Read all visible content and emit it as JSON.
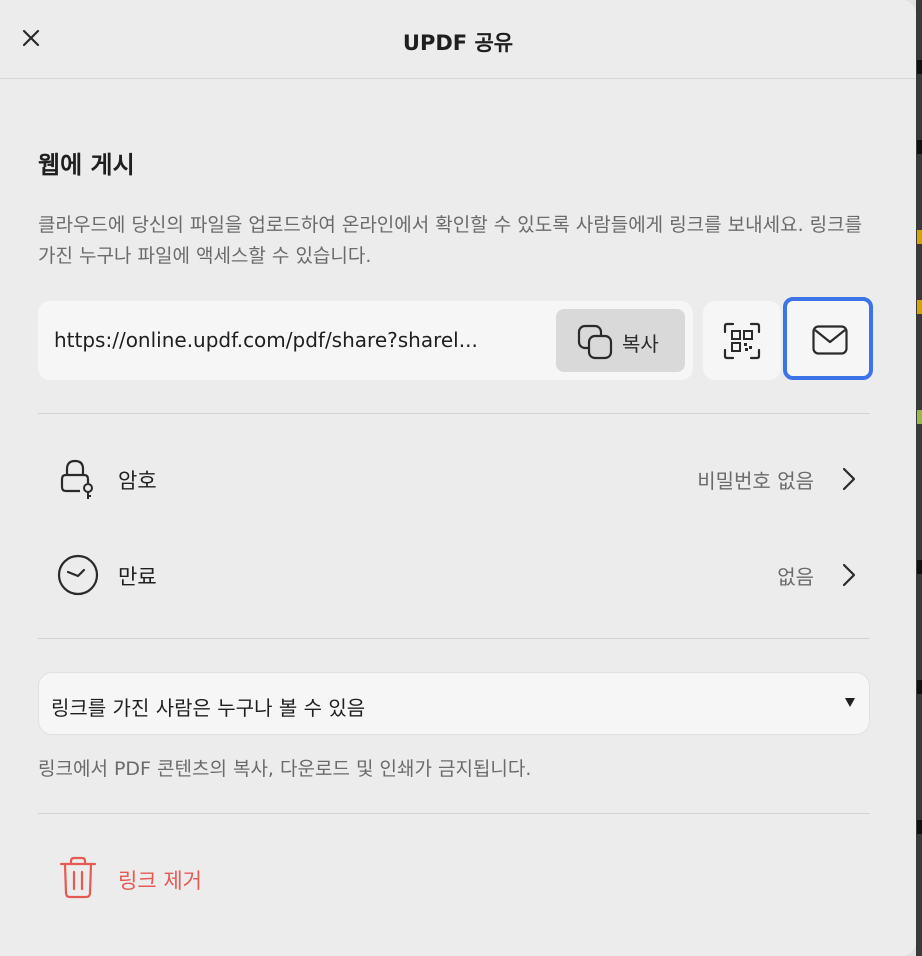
{
  "dialog": {
    "title": "UPDF 공유"
  },
  "publish": {
    "section_title": "웹에 게시",
    "description": "클라우드에 당신의 파일을 업로드하여 온라인에서 확인할 수 있도록 사람들에게 링크를 보내세요. 링크를 가진 누구나 파일에 액세스할 수 있습니다.",
    "url": "https://online.updf.com/pdf/share?sharel...",
    "copy_label": "복사"
  },
  "settings": {
    "password": {
      "label": "암호",
      "value": "비밀번호 없음"
    },
    "expiry": {
      "label": "만료",
      "value": "없음"
    }
  },
  "access": {
    "selected": "링크를 가진 사람은 누구나 볼 수 있음",
    "note": "링크에서 PDF 콘텐츠의 복사, 다운로드 및 인쇄가 금지됩니다."
  },
  "remove_link": {
    "label": "링크 제거"
  },
  "colors": {
    "accent": "#3b73e8",
    "danger": "#e65a55",
    "dialog_bg": "#ececec"
  },
  "icons": {
    "close": "close-icon",
    "copy": "copy-icon",
    "qr": "qr-code-icon",
    "mail": "mail-icon",
    "lock": "lock-icon",
    "clock": "clock-icon",
    "chevron": "chevron-right-icon",
    "trash": "trash-icon"
  }
}
